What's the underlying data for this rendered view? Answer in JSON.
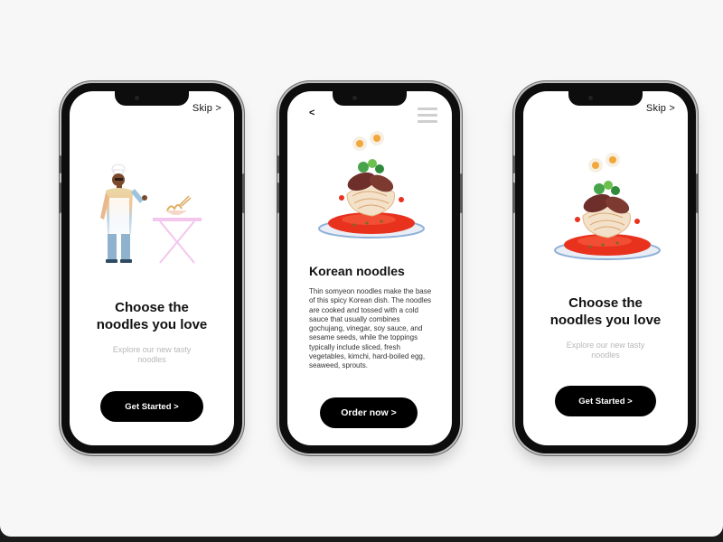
{
  "screens": [
    {
      "skip_label": "Skip >",
      "title_line1": "Choose the",
      "title_line2": "noodles you love",
      "subtitle_line1": "Explore our new tasty",
      "subtitle_line2": "noodles",
      "cta_label": "Get Started >"
    },
    {
      "back_label": "<",
      "heading": "Korean noodles",
      "description": "Thin somyeon noodles make the base of this spicy Korean dish. The noodles are cooked and tossed with a cold sauce that usually combines gochujang, vinegar, soy sauce, and sesame seeds, while the toppings typically include sliced, fresh vegetables, kimchi, hard-boiled egg, seaweed, sprouts.",
      "cta_label": "Order now >"
    },
    {
      "skip_label": "Skip >",
      "title_line1": "Choose the",
      "title_line2": "noodles you love",
      "subtitle_line1": "Explore our new tasty",
      "subtitle_line2": "noodles",
      "cta_label": "Get Started >"
    }
  ],
  "colors": {
    "background": "#f7f7f7",
    "button": "#000000",
    "subtitle": "#b8b8b8",
    "sauce": "#e8321e"
  },
  "icons": [
    "chef-illustration",
    "noodle-dish-illustration",
    "hamburger-menu-icon",
    "back-chevron"
  ]
}
